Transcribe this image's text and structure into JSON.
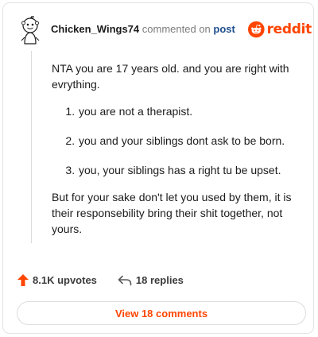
{
  "comment": {
    "username": "Chicken_Wings74",
    "action": "commented on",
    "target": "post",
    "brand": "reddit",
    "intro": "NTA you are 17 years old. and you are right with evrything.",
    "points": [
      "you are not a therapist.",
      "you and your siblings dont ask to be born.",
      "you, your siblings has a right tu be upset."
    ],
    "closing": "But for your sake don't let you used by them, it is their responsebility bring their shit together, not yours."
  },
  "footer": {
    "upvotes": "8.1K upvotes",
    "replies": "18 replies",
    "view_comments": "View 18 comments"
  },
  "colors": {
    "brand": "#ff4500",
    "link": "#1f4f8f",
    "muted": "#7c7c7c"
  },
  "icons": {
    "avatar": "snoo-avatar",
    "brand": "reddit-logo",
    "upvote": "upvote-arrow-icon",
    "reply": "reply-arrow-icon"
  }
}
